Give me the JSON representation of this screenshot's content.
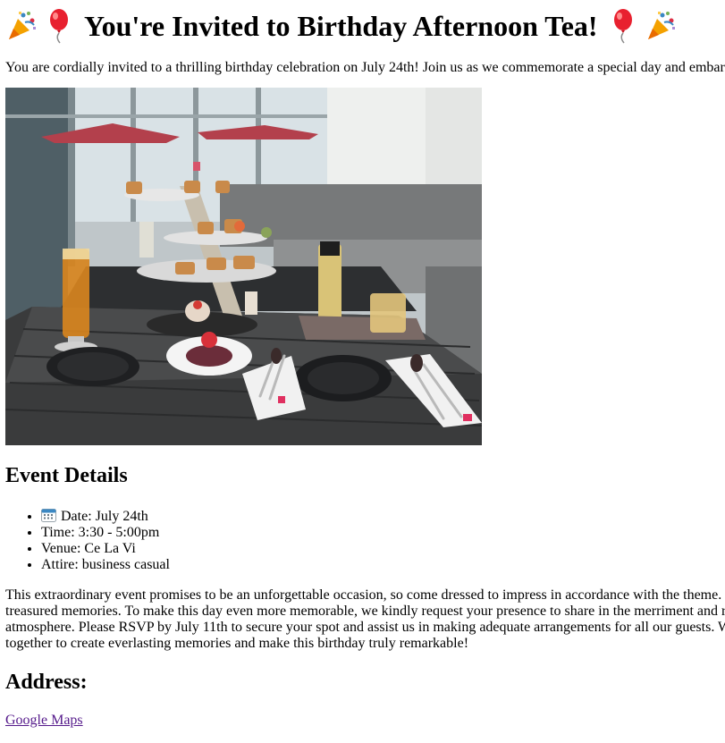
{
  "header": {
    "title": "You're Invited to Birthday Afternoon Tea!",
    "left_icons": [
      "party-popper-icon",
      "balloon-icon"
    ],
    "right_icons": [
      "balloon-icon",
      "party-popper-icon"
    ]
  },
  "intro": {
    "text": "You are cordially invited to a thrilling birthday celebration on July 24th! Join us as we commemorate a special day and embar"
  },
  "photo": {
    "alt": "Afternoon tea set on a table"
  },
  "details": {
    "heading": "Event Details",
    "date_icon": "calendar-icon",
    "date": "Date: July 24th",
    "time": "Time: 3:30 - 5:00pm",
    "venue": "Venue: Ce La Vi",
    "attire": "Attire: business casual"
  },
  "body": {
    "line1": "This extraordinary event promises to be an unforgettable occasion, so come dressed to impress in accordance with the theme.",
    "line2": "treasured memories. To make this day even more memorable, we kindly request your presence to share in the merriment and r",
    "line3": "atmosphere. Please RSVP by July 11th to secure your spot and assist us in making adequate arrangements for all our guests. W",
    "line4": "together to create everlasting memories and make this birthday truly remarkable!"
  },
  "address": {
    "heading": "Address:",
    "link_label": "Google Maps"
  },
  "colors": {
    "link": "#551a8b",
    "balloon": "#e8202f",
    "text": "#000000"
  }
}
